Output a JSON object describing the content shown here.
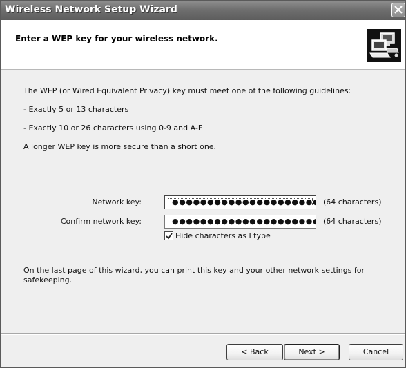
{
  "window": {
    "title": "Wireless Network Setup Wizard"
  },
  "header": {
    "title": "Enter a WEP key for your wireless network.",
    "icon": "network-computers-icon"
  },
  "body": {
    "intro": "The WEP (or Wired Equivalent Privacy) key must meet one of the following guidelines:",
    "guideline_1": "- Exactly 5 or 13 characters",
    "guideline_2": "- Exactly 10 or 26 characters using 0-9 and A-F",
    "note": "A longer WEP key is more secure than a short one.",
    "footer_line_1": "On the last page of this wizard, you can print this key and your other network settings for",
    "footer_line_2": "safekeeping."
  },
  "form": {
    "network_key_label": "Network key:",
    "network_key_value": "●●●●●●●●●●●●●●●●●●●●●●●●●●●",
    "network_key_count": "(64 characters)",
    "confirm_key_label": "Confirm network key:",
    "confirm_key_value": "●●●●●●●●●●●●●●●●●●●●●●●●●●●",
    "confirm_key_count": "(64 characters)",
    "hide_chars_label": "Hide characters as I type",
    "hide_chars_checked": true
  },
  "buttons": {
    "back": "< Back",
    "next": "Next >",
    "cancel": "Cancel"
  }
}
